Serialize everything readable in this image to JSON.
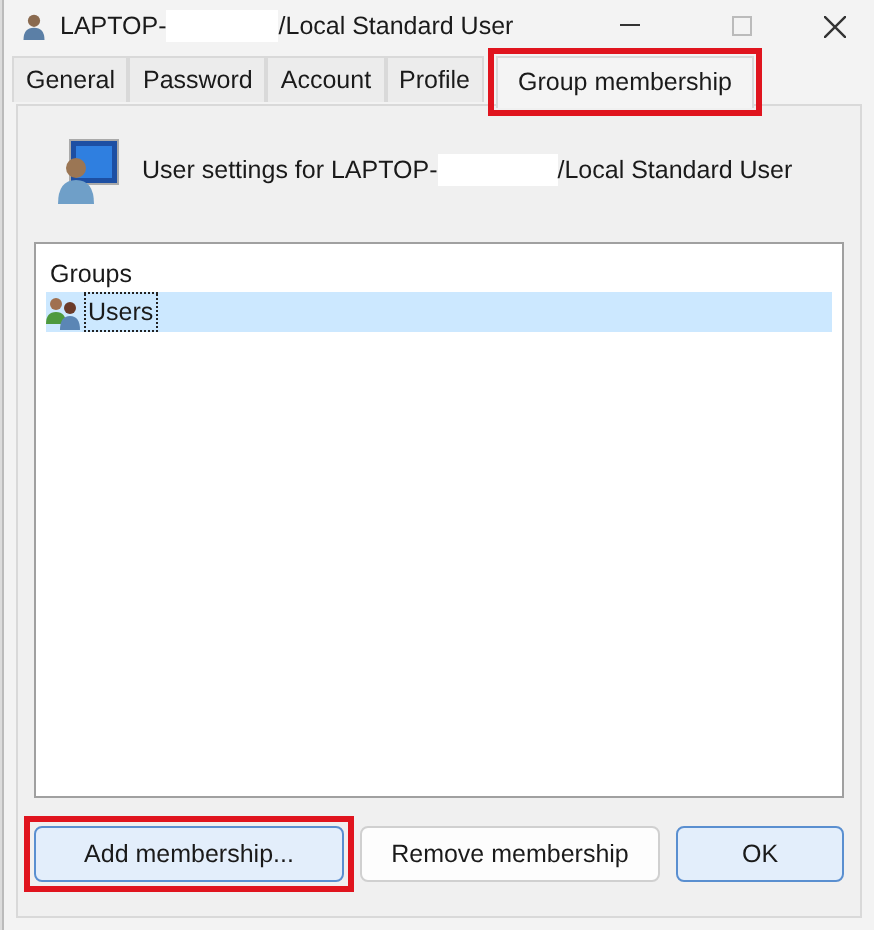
{
  "window": {
    "title_start": "LAPTOP-",
    "title_end": "/Local Standard User"
  },
  "tabs": [
    {
      "label": "General",
      "selected": false,
      "highlighted": false
    },
    {
      "label": "Password",
      "selected": false,
      "highlighted": false
    },
    {
      "label": "Account",
      "selected": false,
      "highlighted": false
    },
    {
      "label": "Profile",
      "selected": false,
      "highlighted": false
    },
    {
      "label": "Group membership",
      "selected": true,
      "highlighted": true
    }
  ],
  "header": {
    "text_start": "User settings for LAPTOP-",
    "text_end": "/Local Standard User"
  },
  "groups": {
    "heading": "Groups",
    "items": [
      {
        "name": "Users",
        "selected": true
      }
    ]
  },
  "buttons": [
    {
      "label": "Add membership...",
      "kind": "default",
      "highlighted": true
    },
    {
      "label": "Remove membership",
      "kind": "plain",
      "highlighted": false
    },
    {
      "label": "OK",
      "kind": "default",
      "highlighted": false
    }
  ]
}
